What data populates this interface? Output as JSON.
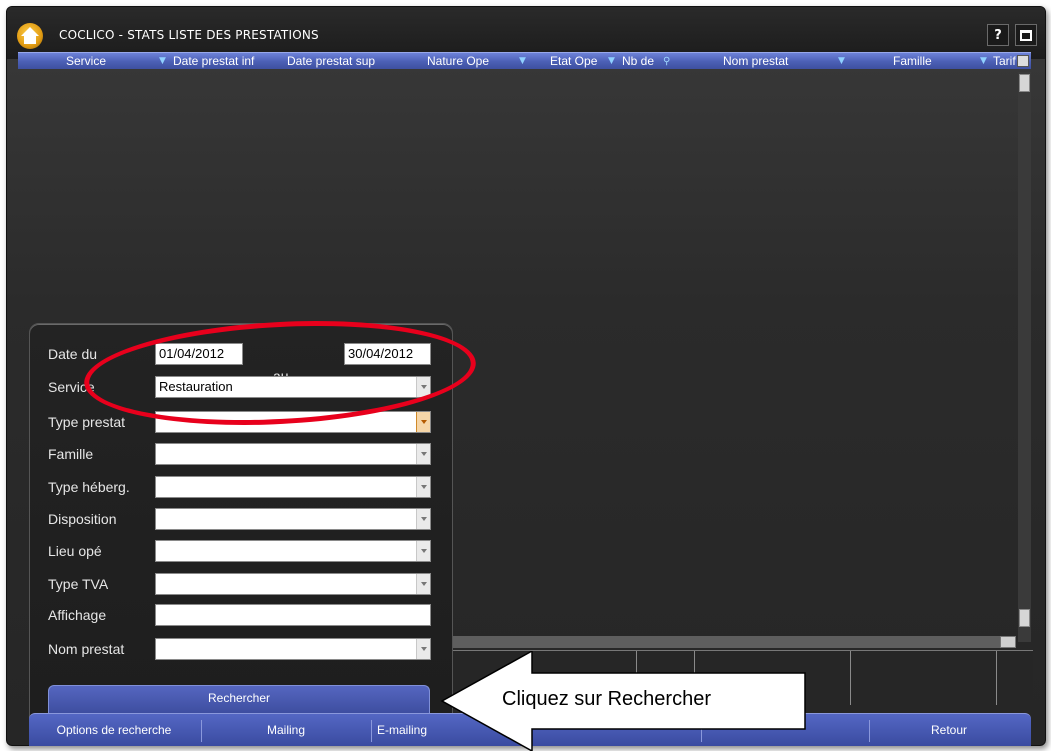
{
  "window": {
    "title": "COCLICO - STATS LISTE DES PRESTATIONS",
    "help_label": "?",
    "app_icon": "house-app-icon",
    "maximize_icon": "maximize-icon"
  },
  "grid": {
    "columns": [
      "Service",
      "Date prestat inf",
      "Date prestat sup",
      "Nature Ope",
      "Etat Ope",
      "Nb de",
      "Nom prestat",
      "Famille",
      "Tarif"
    ],
    "filter_icon": "funnel-filter-icon",
    "header_color": "#4b5fb5"
  },
  "search_form": {
    "date_label": "Date du",
    "date_from": "01/04/2012",
    "au_label": "au",
    "date_to": "30/04/2012",
    "fields": [
      {
        "label": "Service",
        "value": "Restauration"
      },
      {
        "label": "Type prestat",
        "value": ""
      },
      {
        "label": "Famille",
        "value": ""
      },
      {
        "label": "Type héberg.",
        "value": ""
      },
      {
        "label": "Disposition",
        "value": ""
      },
      {
        "label": "Lieu opé",
        "value": ""
      },
      {
        "label": "Type TVA",
        "value": ""
      },
      {
        "label": "Affichage",
        "value": ""
      },
      {
        "label": "Nom prestat",
        "value": ""
      }
    ],
    "search_button": "Rechercher"
  },
  "bottom_bar": {
    "options": "Options de recherche",
    "mailing": "Mailing",
    "emailing": "E-mailing",
    "retour": "Retour"
  },
  "annotation": {
    "callout_text": "Cliquez sur Rechercher",
    "highlight_color": "#e8001c"
  }
}
